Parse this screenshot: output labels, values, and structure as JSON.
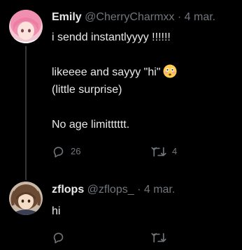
{
  "tweets": [
    {
      "display_name": "Emily",
      "handle": "@CherryCharmxx",
      "separator": "·",
      "date": "4 mar.",
      "lines": [
        "i sendd instantlyyyy !!!!!!",
        "",
        "likeeee and sayyy \"hi\"",
        "(little surprise)",
        "",
        "No age limitttttt."
      ],
      "emoji": "flushed-face-emoji",
      "reply_count": "26",
      "retweet_count": "4"
    },
    {
      "display_name": "zflops",
      "handle": "@zflops_",
      "separator": "·",
      "date": "4 mar.",
      "lines": [
        "hi"
      ]
    }
  ],
  "colors": {
    "background": "#000000",
    "primary_text": "#e7e9ea",
    "secondary_text": "#71767b",
    "thread_line": "#333639"
  },
  "icons": {
    "reply": "reply-icon",
    "retweet": "retweet-icon"
  }
}
